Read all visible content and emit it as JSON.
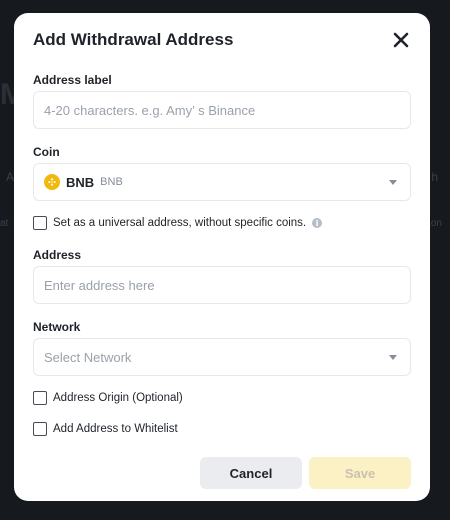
{
  "background": {
    "frag_m": "M",
    "frag_a": "A",
    "frag_at": "at",
    "frag_h": "h",
    "frag_on": "on"
  },
  "modal": {
    "title": "Add Withdrawal Address",
    "close_icon": "close-icon",
    "address_label": {
      "label": "Address label",
      "placeholder": "4-20 characters. e.g. Amy’ s Binance",
      "value": ""
    },
    "coin": {
      "label": "Coin",
      "symbol": "BNB",
      "name": "BNB",
      "icon": "bnb-coin-icon",
      "icon_color": "#f0b90b"
    },
    "universal": {
      "label": "Set as a universal address, without specific coins.",
      "checked": false,
      "info_icon": "info-icon"
    },
    "address": {
      "label": "Address",
      "placeholder": "Enter address here",
      "value": ""
    },
    "network": {
      "label": "Network",
      "placeholder": "Select Network"
    },
    "origin": {
      "label": "Address Origin (Optional)",
      "checked": false
    },
    "whitelist": {
      "label": "Add Address to Whitelist",
      "checked": false
    },
    "buttons": {
      "cancel": "Cancel",
      "save": "Save"
    }
  },
  "colors": {
    "accent": "#f0b90b",
    "save_disabled_bg": "#fcf0c5",
    "cancel_bg": "#eaecef",
    "overlay_bg": "#161a1e"
  }
}
